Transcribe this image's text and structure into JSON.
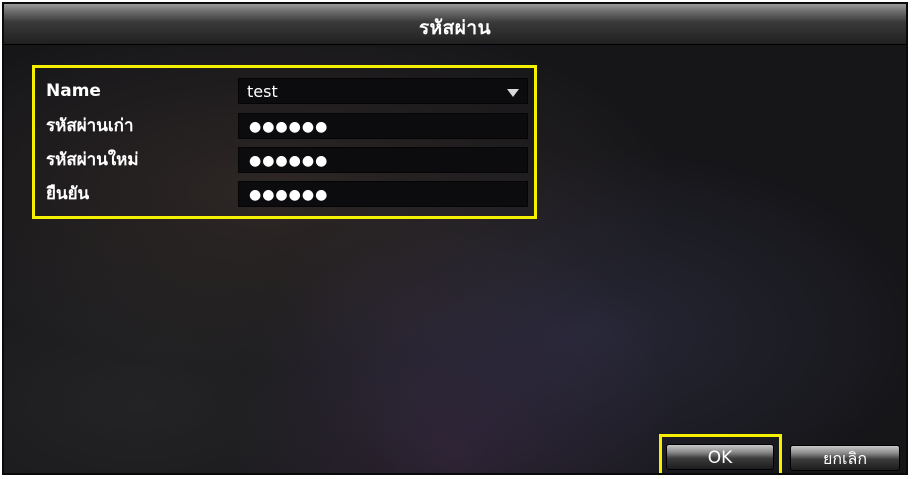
{
  "dialog": {
    "title": "รหัสผ่าน"
  },
  "form": {
    "name_label": "Name",
    "name_value": "test",
    "old_password_label": "รหัสผ่านเก่า",
    "old_password_value": "●●●●●●",
    "new_password_label": "รหัสผ่านใหม่",
    "new_password_value": "●●●●●●",
    "confirm_label": "ยืนยัน",
    "confirm_value": "●●●●●●"
  },
  "buttons": {
    "ok_label": "OK",
    "cancel_label": "ยกเลิก"
  },
  "colors": {
    "highlight": "#f4f000",
    "background": "#161619",
    "text": "#ffffff"
  },
  "icons": {
    "dropdown": "chevron-down-icon"
  }
}
